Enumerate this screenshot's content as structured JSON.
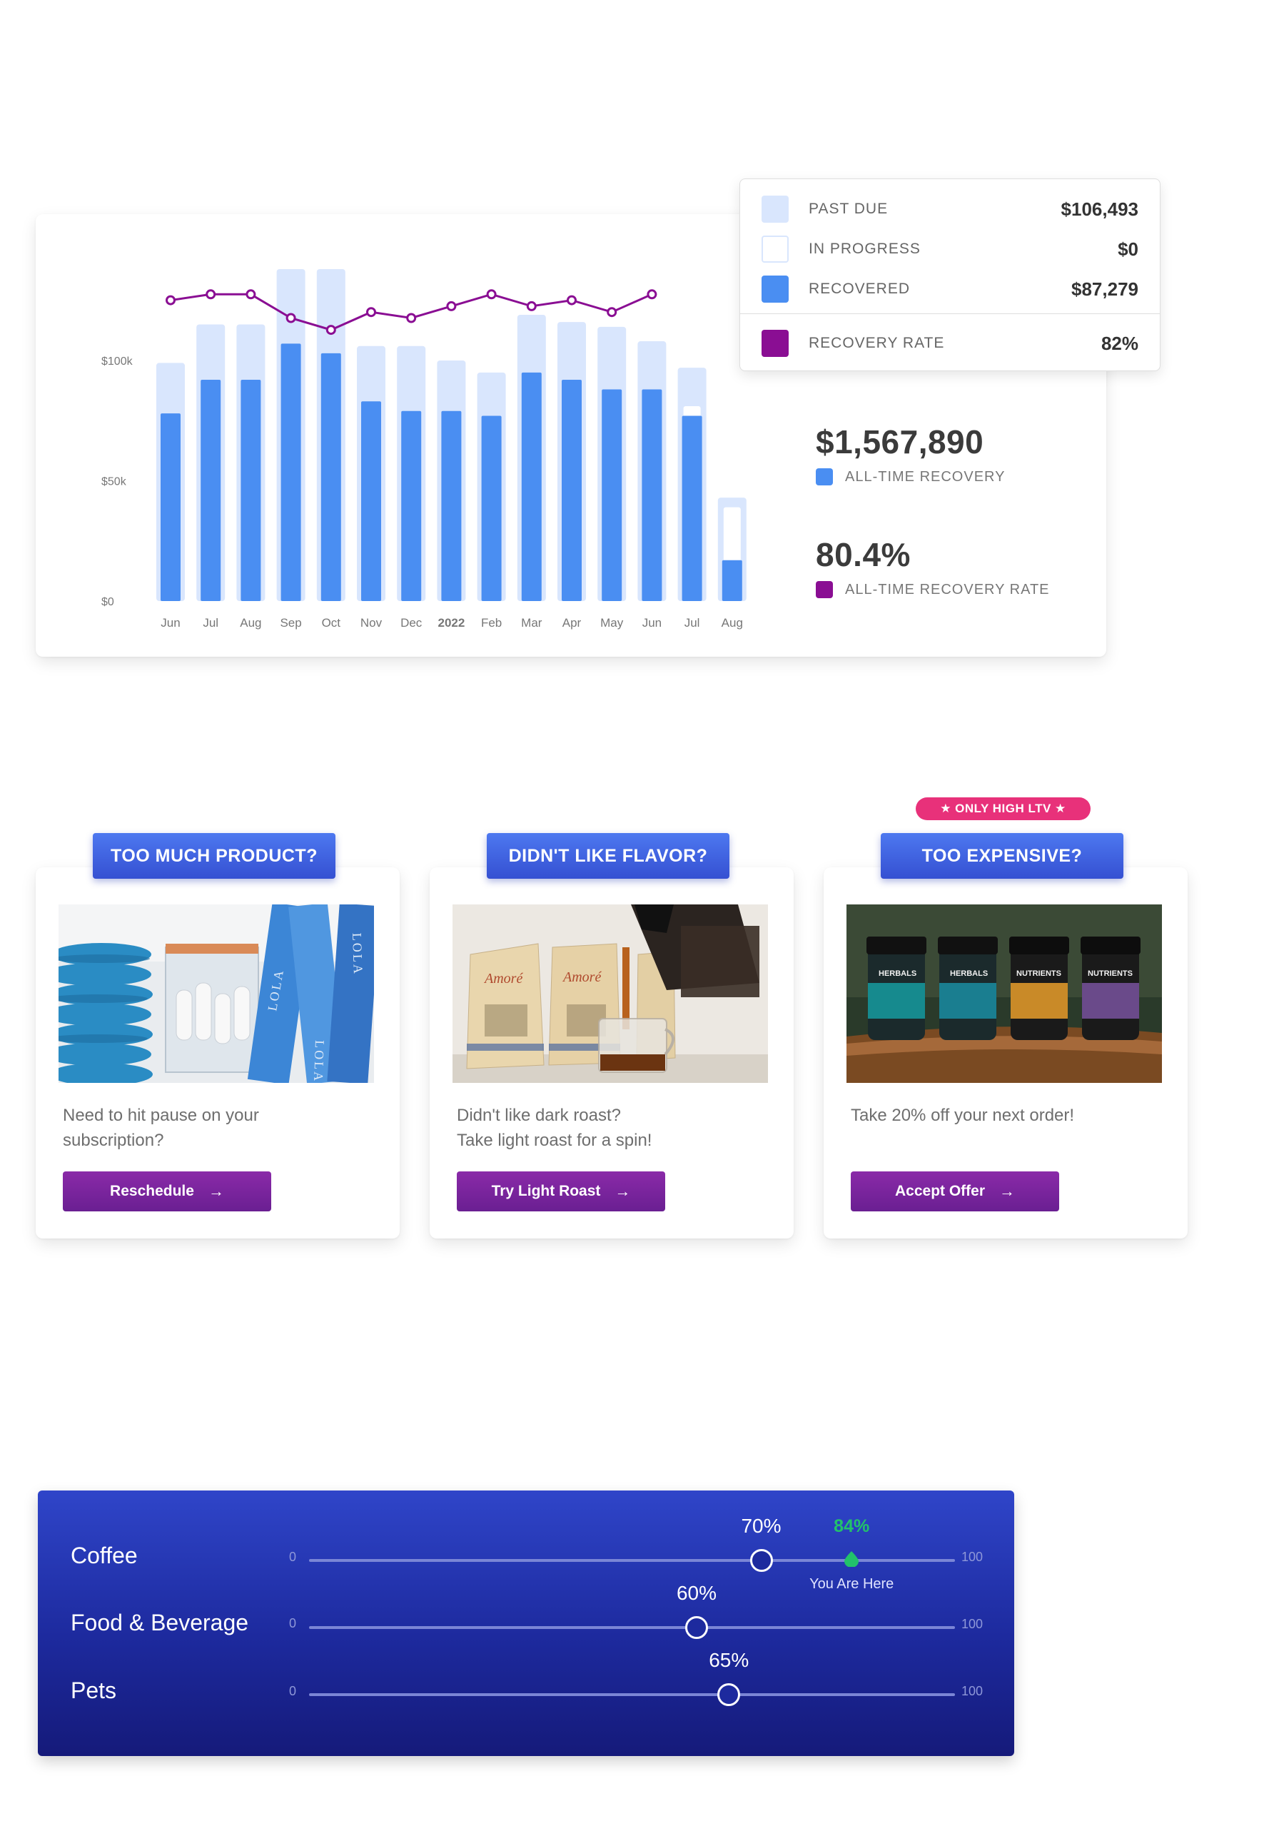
{
  "colors": {
    "past_due": "#d9e6fd",
    "in_progress": "#ffffff",
    "recovered": "#4a8ef2",
    "recovery_rate": "#8a0e93",
    "tab": "#3f61e0",
    "button": "#7a249c",
    "badge": "#e8317a",
    "benchmark_bg": "#1d2a9e",
    "you_are_here": "#22c26a"
  },
  "chart_data": {
    "type": "bar",
    "categories": [
      "Jun",
      "Jul",
      "Aug",
      "Sep",
      "Oct",
      "Nov",
      "Dec",
      "2022",
      "Feb",
      "Mar",
      "Apr",
      "May",
      "Jun",
      "Jul",
      "Aug"
    ],
    "series": [
      {
        "name": "PAST DUE",
        "values": [
          99,
          115,
          115,
          138,
          138,
          106,
          106,
          100,
          95,
          119,
          116,
          114,
          108,
          97,
          43
        ]
      },
      {
        "name": "IN PROGRESS",
        "values": [
          0,
          0,
          0,
          0,
          0,
          0,
          0,
          0,
          0,
          0,
          0,
          0,
          0,
          81,
          39
        ]
      },
      {
        "name": "RECOVERED",
        "values": [
          78,
          92,
          92,
          107,
          103,
          83,
          79,
          79,
          77,
          95,
          92,
          88,
          88,
          77,
          17
        ]
      },
      {
        "name": "RECOVERY RATE",
        "values": [
          80,
          81,
          81,
          77,
          75,
          78,
          77,
          79,
          81,
          79,
          80,
          78,
          81
        ]
      }
    ],
    "yticks": [
      "$0",
      "$50k",
      "$100k"
    ],
    "ylim": [
      0,
      138
    ],
    "legend_position": "top-right",
    "grid": false
  },
  "legend": {
    "items": [
      {
        "label": "PAST DUE",
        "value": "$106,493"
      },
      {
        "label": "IN PROGRESS",
        "value": "$0"
      },
      {
        "label": "RECOVERED",
        "value": "$87,279"
      },
      {
        "label": "RECOVERY RATE",
        "value": "82%"
      }
    ]
  },
  "stats": {
    "all_time_recovery_value": "$1,567,890",
    "all_time_recovery_label": "ALL-TIME RECOVERY",
    "all_time_rate_value": "80.4%",
    "all_time_rate_label": "ALL-TIME RECOVERY RATE"
  },
  "offers": [
    {
      "tab": "TOO MUCH PRODUCT?",
      "text_line1": "Need to hit pause on your",
      "text_line2": "subscription?",
      "button": "Reschedule",
      "image": "tampon-boxes-image"
    },
    {
      "tab": "DIDN'T LIKE FLAVOR?",
      "text_line1": "Didn't like dark roast?",
      "text_line2": "Take light roast for a spin!",
      "button": "Try Light Roast",
      "image": "coffee-bags-image"
    },
    {
      "badge": "★ ONLY HIGH LTV ★",
      "tab": "TOO EXPENSIVE?",
      "text_line1": "Take 20% off your next order!",
      "text_line2": "",
      "button": "Accept Offer",
      "image": "supplement-bottles-image"
    }
  ],
  "benchmark": {
    "rows": [
      {
        "label": "Coffee",
        "min": "0",
        "max": "100",
        "value": 70,
        "value_label": "70%"
      },
      {
        "label": "Food & Beverage",
        "min": "0",
        "max": "100",
        "value": 60,
        "value_label": "60%"
      },
      {
        "label": "Pets",
        "min": "0",
        "max": "100",
        "value": 65,
        "value_label": "65%"
      }
    ],
    "you": {
      "value": 84,
      "value_label": "84%",
      "label": "You Are Here"
    }
  }
}
